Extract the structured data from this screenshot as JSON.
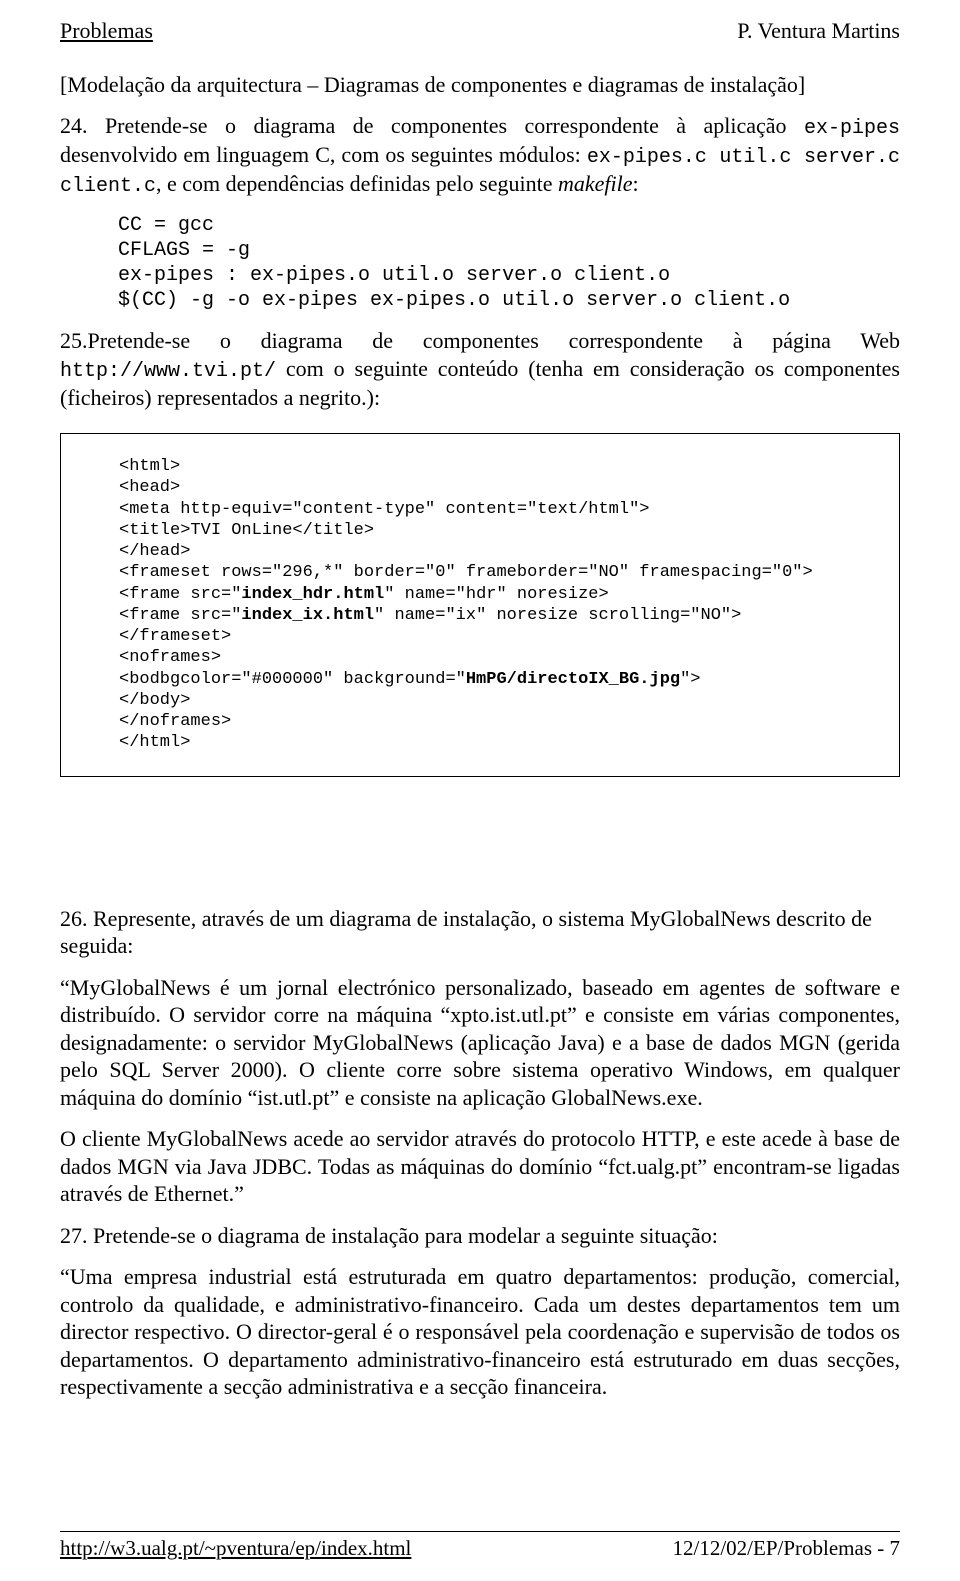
{
  "header": {
    "left": "Problemas",
    "right": "P. Ventura Martins"
  },
  "section_title": "[Modelação da arquitectura – Diagramas de componentes e diagramas de instalação]",
  "p24_a": "24. Pretende-se o diagrama de componentes correspondente à aplicação ",
  "p24_b": " desenvolvido em linguagem C, com os seguintes módulos: ",
  "p24_c": "ex-pipes.c util.c server.c client.c",
  "p24_d": ", e com dependências definidas pelo seguinte ",
  "p24_e": "makefile",
  "p24_f": ":",
  "ex_pipes": "ex-pipes",
  "makefile": "CC = gcc\nCFLAGS = -g\nex-pipes : ex-pipes.o util.o server.o client.o\n$(CC) -g -o ex-pipes ex-pipes.o util.o server.o client.o",
  "p25_a": "25.Pretende-se o diagrama de componentes correspondente à página Web ",
  "p25_b": "http://www.tvi.pt/",
  "p25_c": " com o seguinte conteúdo (tenha em consideração os componentes (ficheiros) representados a negrito.):",
  "html_code": {
    "l1": "<html>",
    "l2": "<head>",
    "l3": "<meta http-equiv=\"content-type\" content=\"text/html\">",
    "l4": "<title>TVI OnLine</title>",
    "l5": "</head>",
    "l6": "<frameset rows=\"296,*\" border=\"0\" frameborder=\"NO\" framespacing=\"0\">",
    "l7a": "<frame src=\"",
    "l7b": "index_hdr.html",
    "l7c": "\" name=\"hdr\" noresize>",
    "l8a": "<frame src=\"",
    "l8b": "index_ix.html",
    "l8c": "\" name=\"ix\" noresize scrolling=\"NO\">",
    "l9": "</frameset>",
    "l10": "<noframes>",
    "l11a": "<bodbgcolor=\"#000000\" background=\"",
    "l11b": "HmPG/directoIX_BG.jpg",
    "l11c": "\">",
    "l12": "</body>",
    "l13": "</noframes>",
    "l14": "</html>"
  },
  "p26": "26. Represente, através de um diagrama de instalação, o sistema MyGlobalNews descrito de seguida:",
  "p26q1": "“MyGlobalNews é um jornal electrónico personalizado, baseado em agentes de software e distribuído. O servidor corre na máquina “xpto.ist.utl.pt” e consiste em várias componentes, designadamente: o servidor MyGlobalNews (aplicação Java) e a base de dados MGN (gerida pelo SQL Server 2000). O cliente corre sobre sistema operativo Windows, em qualquer máquina do domínio “ist.utl.pt” e consiste na aplicação GlobalNews.exe.",
  "p26q2": "O cliente MyGlobalNews acede ao servidor através do protocolo HTTP, e este acede à base de dados MGN via Java JDBC. Todas as máquinas do domínio “fct.ualg.pt” encontram-se ligadas através de Ethernet.”",
  "p27_intro": "27. Pretende-se o diagrama de instalação para modelar a seguinte situação:",
  "p27q": "“Uma empresa industrial está estruturada em quatro departamentos: produção, comercial, controlo da qualidade, e administrativo-financeiro. Cada um destes departamentos tem um director respectivo. O director-geral é o responsável pela coordenação e supervisão de todos os departamentos. O departamento administrativo-financeiro está estruturado em duas secções, respectivamente a secção administrativa e a secção financeira.",
  "footer": {
    "left": "http://w3.ualg.pt/~pventura/ep/index.html",
    "right": "12/12/02/EP/Problemas - 7"
  }
}
